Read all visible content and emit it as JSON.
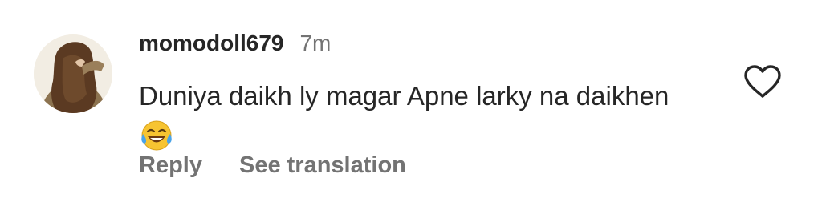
{
  "comment": {
    "username": "momodoll679",
    "timestamp": "7m",
    "text": "Duniya daikh ly magar Apne larky na daikhen",
    "emoji": "face-with-tears-of-joy",
    "actions": {
      "reply_label": "Reply",
      "translate_label": "See translation"
    },
    "like_icon": "heart-outline-icon",
    "avatar_icon": "profile-photo"
  },
  "colors": {
    "primary_text": "#262626",
    "secondary_text": "#737373",
    "background": "#ffffff"
  }
}
